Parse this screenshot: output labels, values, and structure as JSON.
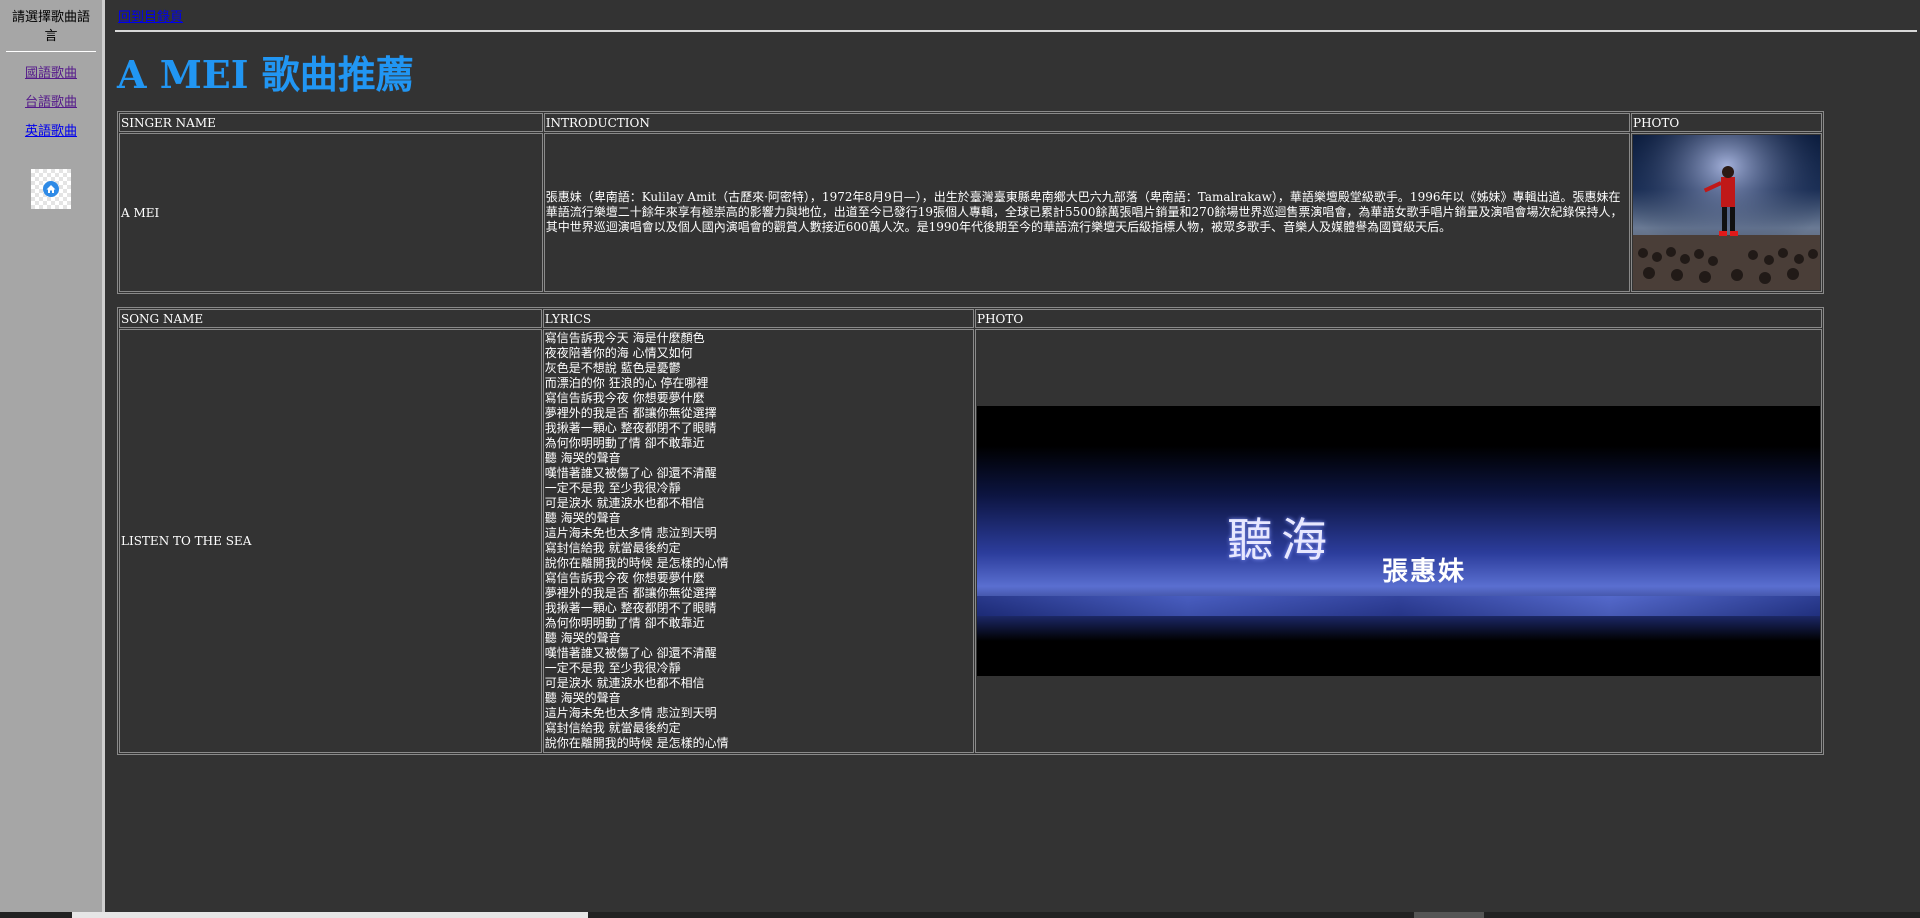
{
  "sidebar": {
    "title": "請選擇歌曲語言",
    "links": [
      "國語歌曲",
      "台語歌曲",
      "英語歌曲"
    ],
    "home_icon": "home-icon"
  },
  "main": {
    "top_link": "回到目錄頁",
    "title": "A MEI 歌曲推薦",
    "singer_table": {
      "headers": [
        "SINGER NAME",
        "INTRODUCTION",
        "PHOTO"
      ],
      "row": {
        "name": "A MEI",
        "introduction": "張惠妹（卑南語：Kulilay Amit（古歷來·阿密特），1972年8月9日—），出生於臺灣臺東縣卑南鄉大巴六九部落（卑南語：Tamalrakaw），華語樂壇殿堂級歌手。1996年以《姊妹》專輯出道。張惠妹在華語流行樂壇二十餘年來享有極崇高的影響力與地位，出道至今已發行19張個人專輯，全球已累計5500餘萬張唱片銷量和270餘場世界巡迴售票演唱會，為華語女歌手唱片銷量及演唱會場次紀錄保持人，其中世界巡迴演唱會以及個人國內演唱會的觀賞人數接近600萬人次。是1990年代後期至今的華語流行樂壇天后級指標人物，被眾多歌手、音樂人及媒體譽為國寶級天后。"
      }
    },
    "song_table": {
      "headers": [
        "SONG NAME",
        "LYRICS",
        "PHOTO"
      ],
      "row": {
        "name": "LISTEN TO THE SEA",
        "lyrics": [
          "寫信告訴我今天 海是什麼顏色",
          "夜夜陪著你的海 心情又如何",
          "灰色是不想說 藍色是憂鬱",
          "而漂泊的你 狂浪的心 停在哪裡",
          "寫信告訴我今夜 你想要夢什麼",
          "夢裡外的我是否 都讓你無從選擇",
          "我揪著一顆心 整夜都閉不了眼睛",
          "為何你明明動了情 卻不敢靠近",
          "聽 海哭的聲音",
          "嘆惜著誰又被傷了心 卻還不清醒",
          "一定不是我 至少我很冷靜",
          "可是淚水 就連淚水也都不相信",
          "聽 海哭的聲音",
          "這片海未免也太多情 悲泣到天明",
          "寫封信給我 就當最後約定",
          "說你在離開我的時候 是怎樣的心情",
          "寫信告訴我今夜 你想要夢什麼",
          "夢裡外的我是否 都讓你無從選擇",
          "我揪著一顆心 整夜都閉不了眼睛",
          "為何你明明動了情 卻不敢靠近",
          "聽 海哭的聲音",
          "嘆惜著誰又被傷了心 卻還不清醒",
          "一定不是我 至少我很冷靜",
          "可是淚水 就連淚水也都不相信",
          "聽 海哭的聲音",
          "這片海未免也太多情 悲泣到天明",
          "寫封信給我 就當最後約定",
          "說你在離開我的時候 是怎樣的心情"
        ],
        "album_art": {
          "title_text": "聽海",
          "artist_text": "張惠妹"
        }
      }
    }
  },
  "colors": {
    "page_bg": "#333333",
    "sidebar_bg": "#a6a6a6",
    "title_blue": "#2196f3",
    "link_blue": "#0000ee",
    "link_visited": "#551a8b"
  }
}
